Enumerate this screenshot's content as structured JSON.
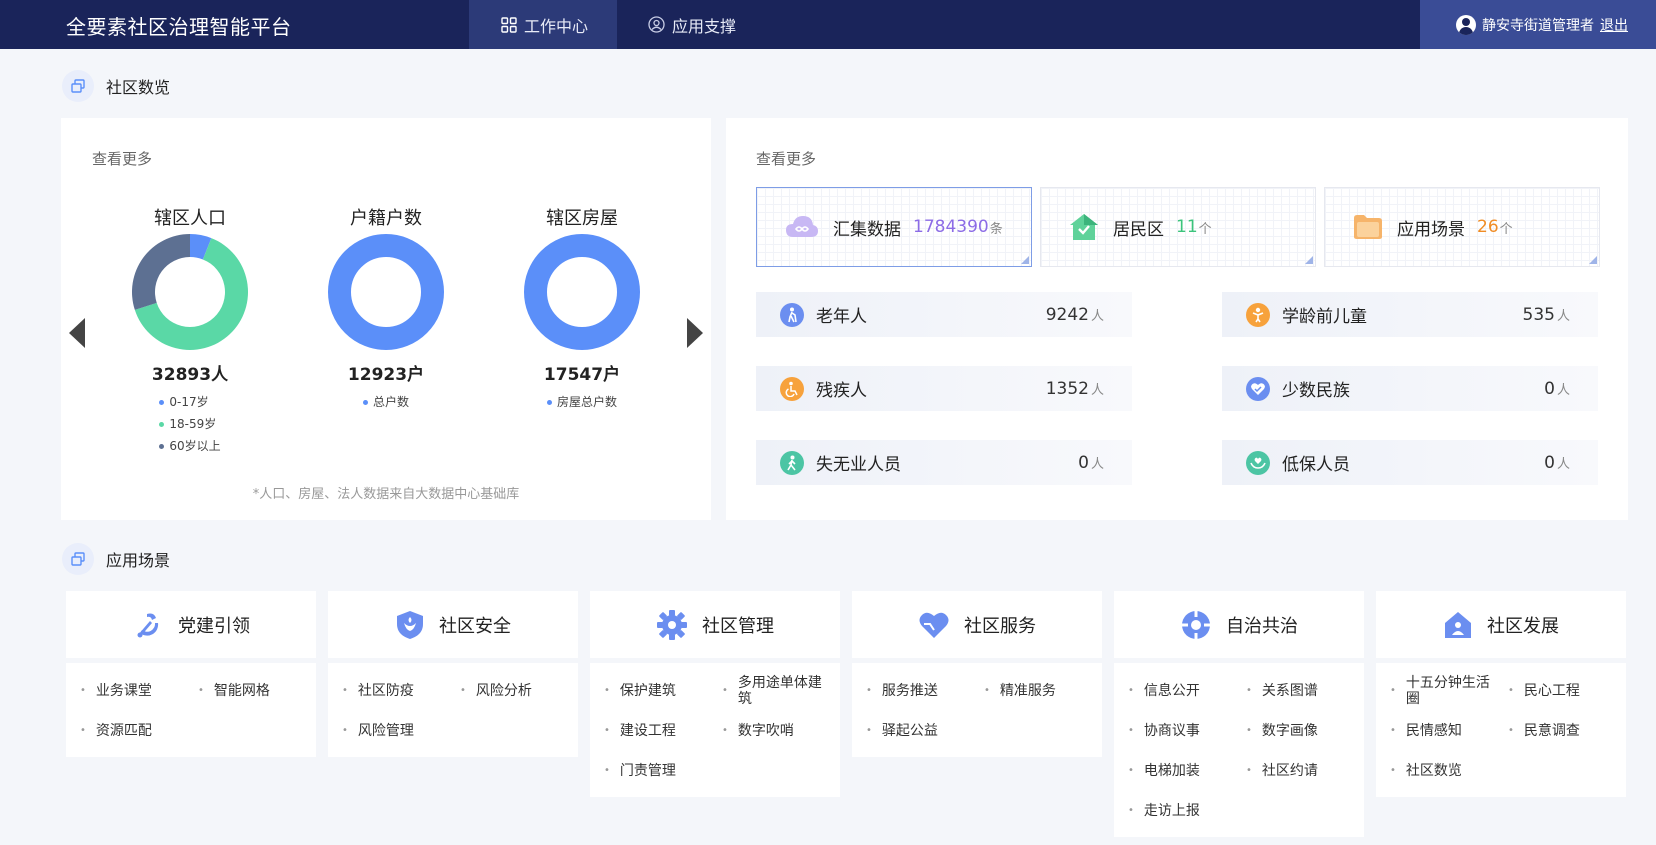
{
  "header": {
    "title": "全要素社区治理智能平台",
    "tabs": [
      {
        "label": "工作中心",
        "active": true
      },
      {
        "label": "应用支撑",
        "active": false
      }
    ],
    "user": "静安寺街道管理者",
    "logout": "退出"
  },
  "overview": {
    "title": "社区数览",
    "left": {
      "view_more": "查看更多",
      "donuts": [
        {
          "title": "辖区人口",
          "total": "32893人",
          "segments": [
            {
              "label": "0-17岁",
              "color": "#5b8ff9",
              "fraction": 0.06
            },
            {
              "label": "18-59岁",
              "color": "#5ad8a6",
              "fraction": 0.64
            },
            {
              "label": "60岁以上",
              "color": "#5d7092",
              "fraction": 0.3
            }
          ]
        },
        {
          "title": "户籍户数",
          "total": "12923户",
          "segments": [
            {
              "label": "总户数",
              "color": "#5b8ff9",
              "fraction": 1.0
            }
          ]
        },
        {
          "title": "辖区房屋",
          "total": "17547户",
          "segments": [
            {
              "label": "房屋总户数",
              "color": "#5b8ff9",
              "fraction": 1.0
            }
          ]
        }
      ],
      "footnote": "*人口、房屋、法人数据来自大数据中心基础库"
    },
    "right": {
      "view_more": "查看更多",
      "cards": [
        {
          "label": "汇集数据",
          "value": "1784390",
          "unit": "条",
          "color": "#8c6ce6",
          "icon": "cloud-icon"
        },
        {
          "label": "居民区",
          "value": "11",
          "unit": "个",
          "color": "#3cc47c",
          "icon": "home-icon"
        },
        {
          "label": "应用场景",
          "value": "26",
          "unit": "个",
          "color": "#f08c24",
          "icon": "folder-icon"
        }
      ],
      "stats": [
        {
          "label": "老年人",
          "value": "9242",
          "unit": "人",
          "color": "#6b8ef0",
          "icon": "elderly-icon"
        },
        {
          "label": "学龄前儿童",
          "value": "535",
          "unit": "人",
          "color": "#f7a23c",
          "icon": "child-icon"
        },
        {
          "label": "残疾人",
          "value": "1352",
          "unit": "人",
          "color": "#f7a23c",
          "icon": "wheelchair-icon"
        },
        {
          "label": "少数民族",
          "value": "0",
          "unit": "人",
          "color": "#6b8ef0",
          "icon": "heart-hands-icon"
        },
        {
          "label": "失无业人员",
          "value": "0",
          "unit": "人",
          "color": "#4cc5a4",
          "icon": "walking-person-icon"
        },
        {
          "label": "低保人员",
          "value": "0",
          "unit": "人",
          "color": "#4cc5a4",
          "icon": "care-icon"
        }
      ]
    }
  },
  "apps": {
    "title": "应用场景",
    "cards": [
      {
        "title": "党建引领",
        "icon": "party-emblem-icon",
        "items": [
          "业务课堂",
          "智能网格",
          "资源匹配"
        ]
      },
      {
        "title": "社区安全",
        "icon": "shield-icon",
        "items": [
          "社区防疫",
          "风险分析",
          "风险管理"
        ]
      },
      {
        "title": "社区管理",
        "icon": "gear-icon",
        "items": [
          "保护建筑",
          "多用途单体建筑",
          "建设工程",
          "数字吹哨",
          "门责管理"
        ]
      },
      {
        "title": "社区服务",
        "icon": "heart-icon",
        "items": [
          "服务推送",
          "精准服务",
          "驿起公益"
        ]
      },
      {
        "title": "自治共治",
        "icon": "lifebuoy-icon",
        "items": [
          "信息公开",
          "关系图谱",
          "协商议事",
          "数字画像",
          "电梯加装",
          "社区约请",
          "走访上报"
        ]
      },
      {
        "title": "社区发展",
        "icon": "house-person-icon",
        "items": [
          "十五分钟生活圈",
          "民心工程",
          "民情感知",
          "民意调查",
          "社区数览"
        ]
      }
    ]
  }
}
